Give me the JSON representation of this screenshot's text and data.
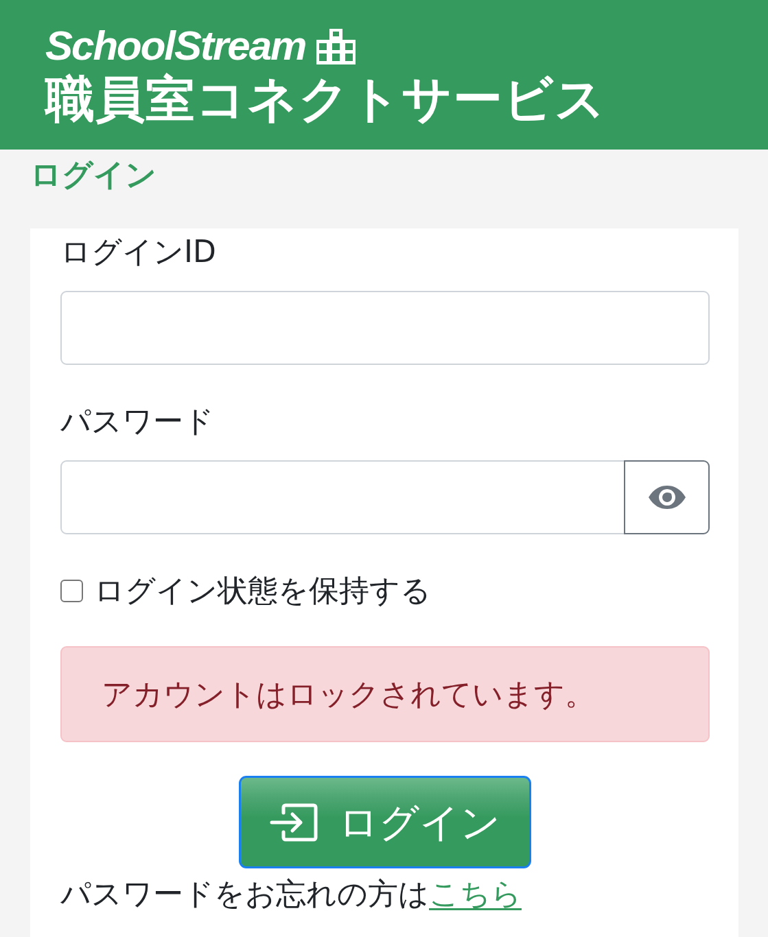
{
  "header": {
    "logo": "SchoolStream",
    "subtitle": "職員室コネクトサービス"
  },
  "page_title": "ログイン",
  "form": {
    "fields": [
      {
        "kind": "text",
        "label": "ログインID"
      },
      {
        "kind": "password",
        "label": "パスワード"
      }
    ],
    "remember": {
      "label": "ログイン状態を保持する",
      "checked": false
    },
    "alert": {
      "kind": "danger",
      "message": "アカウントはロックされています。"
    },
    "submit": {
      "label": "ログイン",
      "focused": true
    },
    "forgot": {
      "text": "パスワードをお忘れの方は",
      "link": "こちら"
    }
  }
}
